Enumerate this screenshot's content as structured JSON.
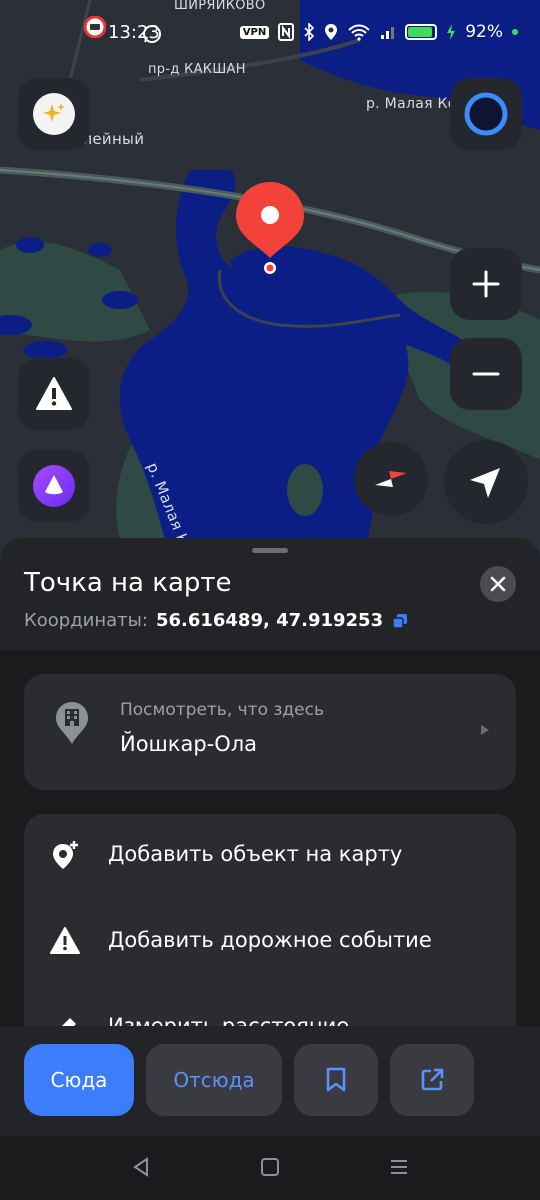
{
  "status_bar": {
    "time": "13:23",
    "vpn": "VPN",
    "battery_percent": "92%",
    "battery_level": 0.92
  },
  "map": {
    "labels": {
      "shiryaikovo": "ШИРЯЙКОВО",
      "kakshan_pass": "пр-д КАКШАН",
      "malaya_kokshaga_top": "р. Малая Ко",
      "yubileyny": "бюлейный",
      "malaya_kokshaga_river": "р. Малая Кокшаг"
    },
    "colors": {
      "water": "#0a1e86",
      "land": "#2b3038",
      "green": "#2c4a43",
      "pin": "#f2423a"
    }
  },
  "sheet": {
    "title": "Точка на карте",
    "coords_label": "Координаты:",
    "coords_value": "56.616489, 47.919253",
    "card_place": {
      "subtitle": "Посмотреть, что здесь",
      "title": "Йошкар-Ола"
    },
    "actions": [
      {
        "label": "Добавить объект на карту",
        "icon": "add-place-icon"
      },
      {
        "label": "Добавить дорожное событие",
        "icon": "warning-icon"
      },
      {
        "label": "Измерить расстояние",
        "icon": "ruler-icon"
      }
    ]
  },
  "bottom_bar": {
    "to_here": "Сюда",
    "from_here": "Отсюда",
    "bookmark_icon": "bookmark-icon",
    "share_icon": "share-icon"
  },
  "accent_color": "#3c7dfc"
}
